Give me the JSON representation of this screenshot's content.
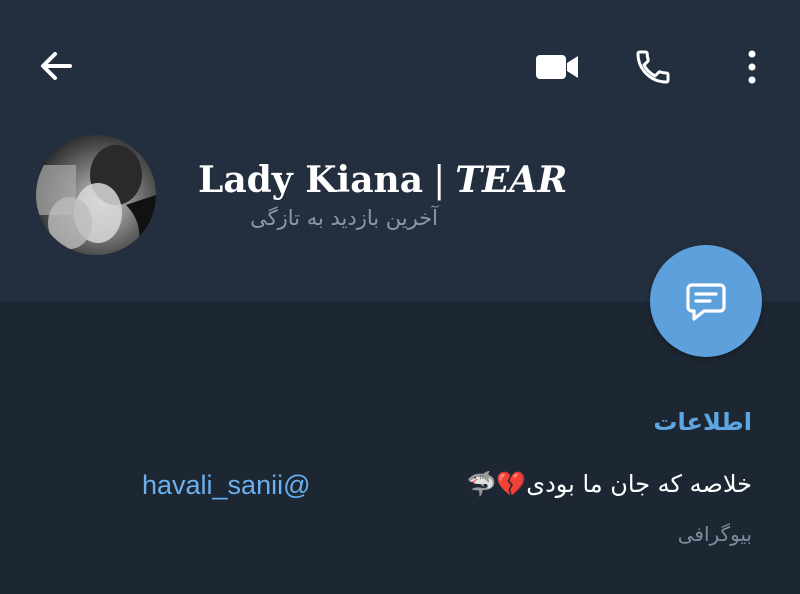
{
  "toolbar": {
    "back_icon": "arrow-left-icon",
    "video_icon": "video-camera-icon",
    "call_icon": "phone-icon",
    "menu_icon": "more-vertical-icon"
  },
  "profile": {
    "name": "Lady Kiana",
    "separator": "|",
    "name_suffix": "TEAR",
    "status": "آخرین بازدید به تازگی"
  },
  "fab": {
    "icon": "message-icon",
    "color": "#5ea0dc"
  },
  "info": {
    "section_title": "اطلاعات",
    "username": "havali_sanii@",
    "bio": "خلاصه که جان ما بودی💔🦈",
    "bio_caption": "بیوگرافی"
  },
  "colors": {
    "header_bg": "#232f3e",
    "page_bg": "#1d2733",
    "accent": "#5ea6e2"
  }
}
